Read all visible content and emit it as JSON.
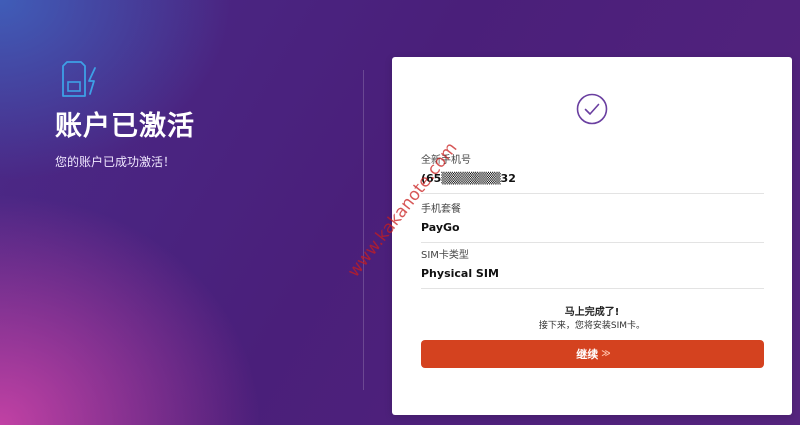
{
  "left": {
    "title": "账户已激活",
    "subtitle": "您的账户已成功激活！"
  },
  "card": {
    "fields": [
      {
        "label": "全新手机号",
        "value": "(65▒▒▒▒▒▒▒32"
      },
      {
        "label": "手机套餐",
        "value": "PayGo"
      },
      {
        "label": "SIM卡类型",
        "value": "Physical SIM"
      }
    ],
    "info_title": "马上完成了!",
    "info_text": "接下来，您将安装SIM卡。",
    "continue_label": "继续",
    "continue_chevron": "≫"
  },
  "watermark": "www.kakanote.com",
  "colors": {
    "accent_purple": "#6a3fa0",
    "button_red": "#d4421f",
    "icon_blue": "#3ea0e6"
  },
  "icons": {
    "sim": "sim-card-lightning-icon",
    "check": "checkmark-circle-icon",
    "chevron": "double-chevron-right-icon"
  }
}
